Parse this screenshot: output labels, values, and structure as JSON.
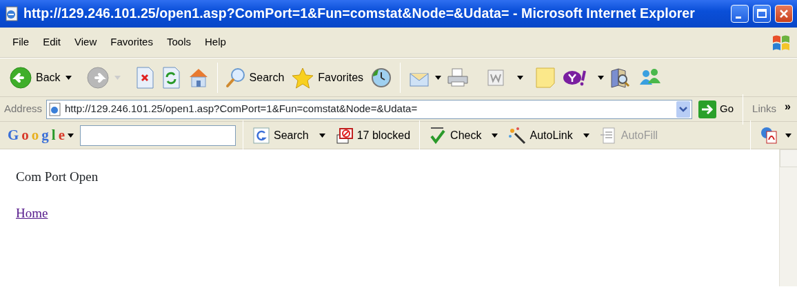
{
  "window": {
    "title": "http://129.246.101.25/open1.asp?ComPort=1&Fun=comstat&Node=&Udata= - Microsoft Internet Explorer"
  },
  "menu": [
    "File",
    "Edit",
    "View",
    "Favorites",
    "Tools",
    "Help"
  ],
  "toolbar": {
    "back": {
      "label": "Back",
      "disabled": false
    },
    "forward": {
      "disabled": true
    },
    "search": {
      "label": "Search"
    },
    "favorites": {
      "label": "Favorites"
    }
  },
  "address_bar": {
    "label": "Address",
    "value": "http://129.246.101.25/open1.asp?ComPort=1&Fun=comstat&Node=&Udata=",
    "go": "Go",
    "links": "Links",
    "more": "»"
  },
  "google_bar": {
    "logo": "Google",
    "buttons": [
      {
        "label": "Search",
        "disabled": false
      },
      {
        "label": "17 blocked",
        "disabled": false
      },
      {
        "label": "Check",
        "disabled": false
      },
      {
        "label": "AutoLink",
        "disabled": false
      },
      {
        "label": "AutoFill",
        "disabled": true
      }
    ]
  },
  "page": {
    "message": "Com Port Open",
    "link": {
      "label": "Home",
      "visited": true
    }
  }
}
